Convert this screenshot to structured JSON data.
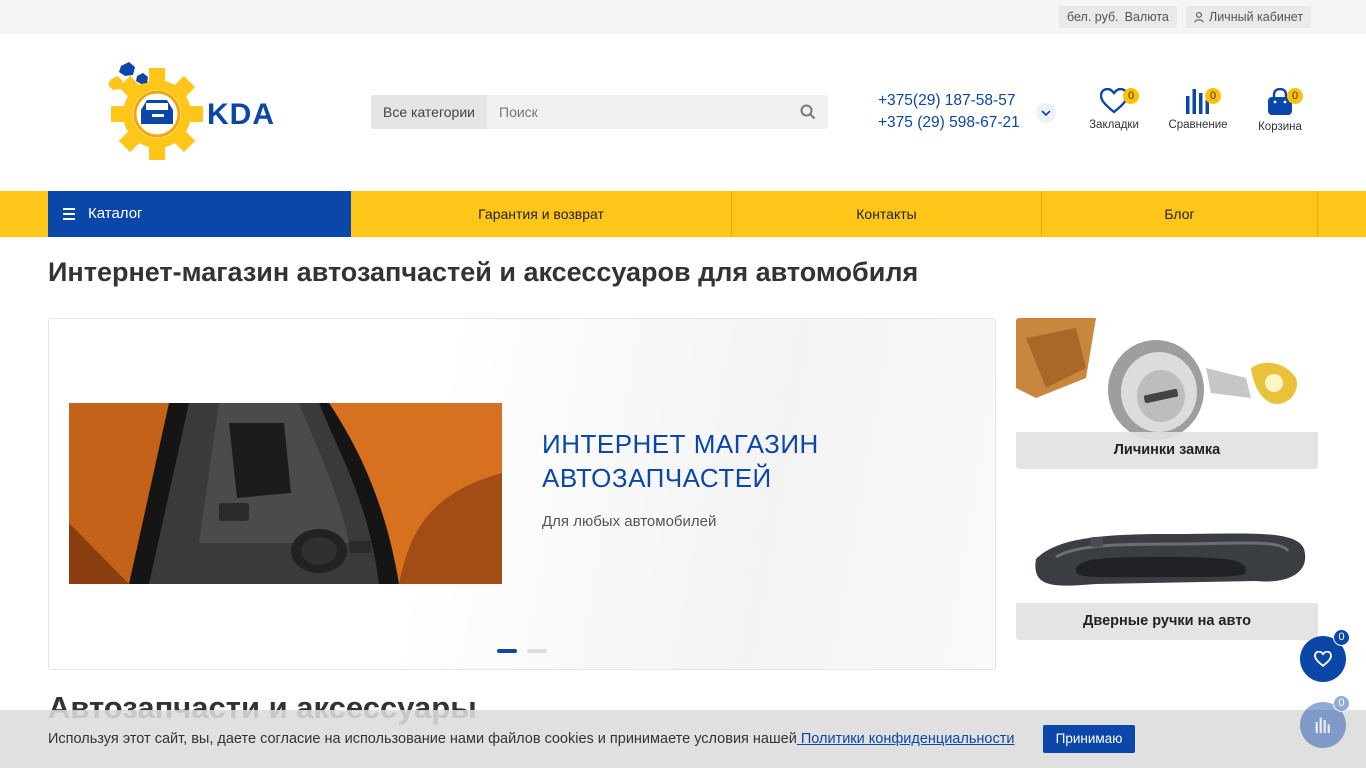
{
  "topbar": {
    "currency_value": "бел. руб.",
    "currency_label": "Валюта",
    "account_label": "Личный кабинет"
  },
  "header": {
    "logo_text": "KDA",
    "search": {
      "category": "Все категории",
      "placeholder": "Поиск"
    },
    "phones": [
      "+375(29) 187-58-57",
      "+375 (29) 598-67-21"
    ],
    "bookmarks": {
      "label": "Закладки",
      "count": "0"
    },
    "compare": {
      "label": "Сравнение",
      "count": "0"
    },
    "cart": {
      "label": "Корзина",
      "count": "0"
    }
  },
  "nav": {
    "catalog": "Каталог",
    "items": [
      "Гарантия и возврат",
      "Контакты",
      "Блог"
    ]
  },
  "main": {
    "title": "Интернет-магазин автозапчастей и аксессуаров для автомобиля",
    "slide": {
      "title_line1": "ИНТЕРНЕТ МАГАЗИН",
      "title_line2": "АВТОЗАПЧАСТЕЙ",
      "subtitle": "Для любых автомобилей"
    },
    "banners": [
      "Личинки замка",
      "Дверные ручки на авто"
    ],
    "section_title": "Автозапчасти и аксессуары"
  },
  "cookie": {
    "text": "Используя этот сайт, вы, даете согласие на использование нами файлов cookies и принимаете условия нашей",
    "link": " Политики конфиденциальности",
    "button": "Принимаю"
  },
  "floating": {
    "bookmarks_count": "0",
    "compare_count": "0"
  },
  "colors": {
    "brand_blue": "#0a47a8",
    "accent_yellow": "#ffc61a"
  }
}
